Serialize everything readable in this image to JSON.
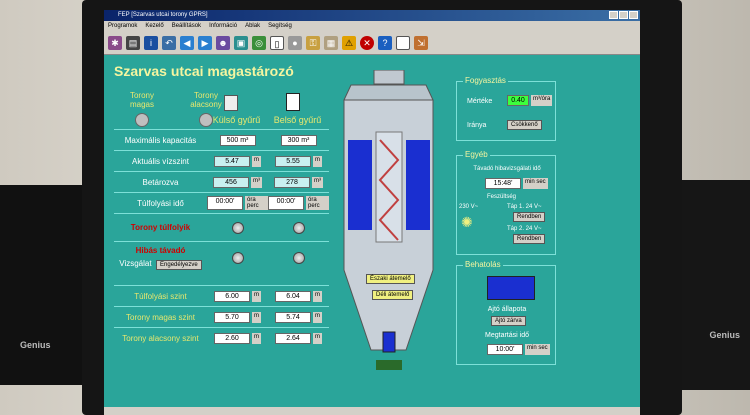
{
  "window": {
    "title": "FEP [Szarvas utcai torony GPRS]"
  },
  "menu": [
    "Programok",
    "Kezelő",
    "Beállítások",
    "Információ",
    "Ablak",
    "Segítség"
  ],
  "page_title": "Szarvas utcai magastározó",
  "lights": {
    "high": "Torony magas",
    "low": "Torony alacsony"
  },
  "columns": {
    "outer": "Külső gyűrű",
    "inner": "Belső gyűrű"
  },
  "rows": {
    "max_capacity": {
      "label": "Maximális kapacitás",
      "outer": "500 m³",
      "inner": "300 m³"
    },
    "current_water": {
      "label": "Aktuális vízszint",
      "outer": "5.47",
      "inner": "5.55",
      "unit": "m"
    },
    "stored": {
      "label": "Betározva",
      "outer": "456",
      "inner": "278",
      "unit": "m³"
    },
    "overflow_time": {
      "label": "Túlfolyási idő",
      "outer": "00:00'",
      "inner": "00:00'",
      "unit": "óra perc"
    },
    "tower_overflow": {
      "label": "Torony túlfolyik"
    },
    "faulty_remote": {
      "label": "Hibás távadó"
    },
    "check": {
      "label": "Vizsgálat",
      "value": "Engedélyezve"
    }
  },
  "levels": {
    "overflow_level": {
      "label": "Túlfolyási szint",
      "outer": "6.00",
      "inner": "6.04",
      "unit": "m"
    },
    "tower_high": {
      "label": "Torony magas szint",
      "outer": "5.70",
      "inner": "5.74",
      "unit": "m"
    },
    "tower_low": {
      "label": "Torony alacsony szint",
      "outer": "2.60",
      "inner": "2.64",
      "unit": "m"
    }
  },
  "tower": {
    "north_valve": "Északi átemelő",
    "south_valve": "Déli átemelő"
  },
  "consumption": {
    "title": "Fogyasztás",
    "amount_label": "Mértéke",
    "amount": "0.40",
    "amount_unit": "m³/óra",
    "direction_label": "Iránya",
    "direction": "Csökkenő"
  },
  "misc": {
    "title": "Egyéb",
    "remote_label": "Távadó hibavizsgálati idő",
    "remote_value": "15:48'",
    "remote_unit": "min sec",
    "voltage_label": "Feszültség",
    "v230": "230 V~",
    "tap1": "Táp 1. 24 V~",
    "tap1_status": "Rendben",
    "tap2": "Táp 2. 24 V~",
    "tap2_status": "Rendben"
  },
  "intrusion": {
    "title": "Behatolás",
    "door_label": "Ajtó állapota",
    "door_value": "Ajtó zárva",
    "hold_label": "Megtartási idő",
    "hold_value": "10:00'",
    "hold_unit": "min sec"
  },
  "speaker_brand": "Genius"
}
